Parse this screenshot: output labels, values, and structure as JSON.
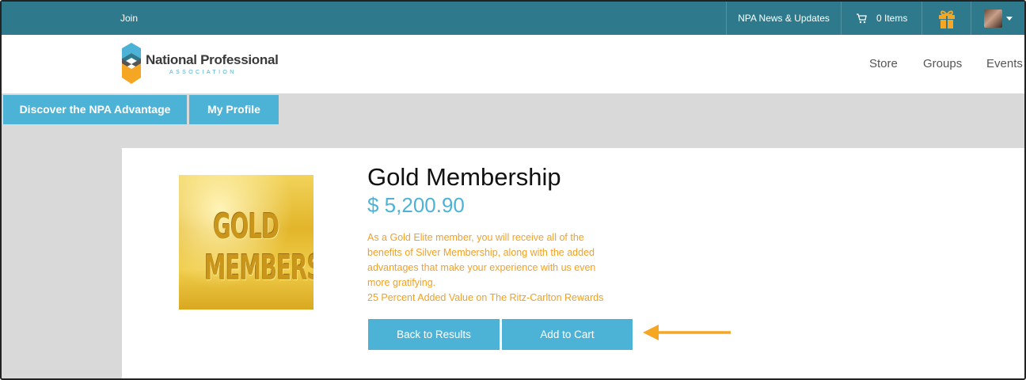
{
  "topbar": {
    "join_label": "Join",
    "news_label": "NPA News & Updates",
    "cart_label": "0 Items",
    "cart_icon": "cart-icon",
    "gift_icon": "gift-icon",
    "avatar_icon": "user-avatar",
    "bg_color": "#2e7a8c"
  },
  "header": {
    "logo_name": "National Professional",
    "logo_sub": "ASSOCIATION",
    "nav": {
      "store": "Store",
      "groups": "Groups",
      "events": "Events"
    }
  },
  "tabs": {
    "discover": "Discover the NPA Advantage",
    "profile": "My Profile"
  },
  "product": {
    "image_line1": "GOLD",
    "image_line2": "MEMBERSHIP",
    "title": "Gold Membership",
    "price": "$ 5,200.90",
    "desc_lines": [
      "As a Gold Elite member, you will receive all of the",
      "benefits of Silver Membership, along with the added",
      "advantages that make your experience with us even",
      "more gratifying.",
      "25 Percent Added Value on The Ritz-Carlton Rewards"
    ],
    "back_label": "Back to Results",
    "add_label": "Add to Cart"
  },
  "colors": {
    "accent": "#4db3d6",
    "orange": "#f0a126"
  }
}
